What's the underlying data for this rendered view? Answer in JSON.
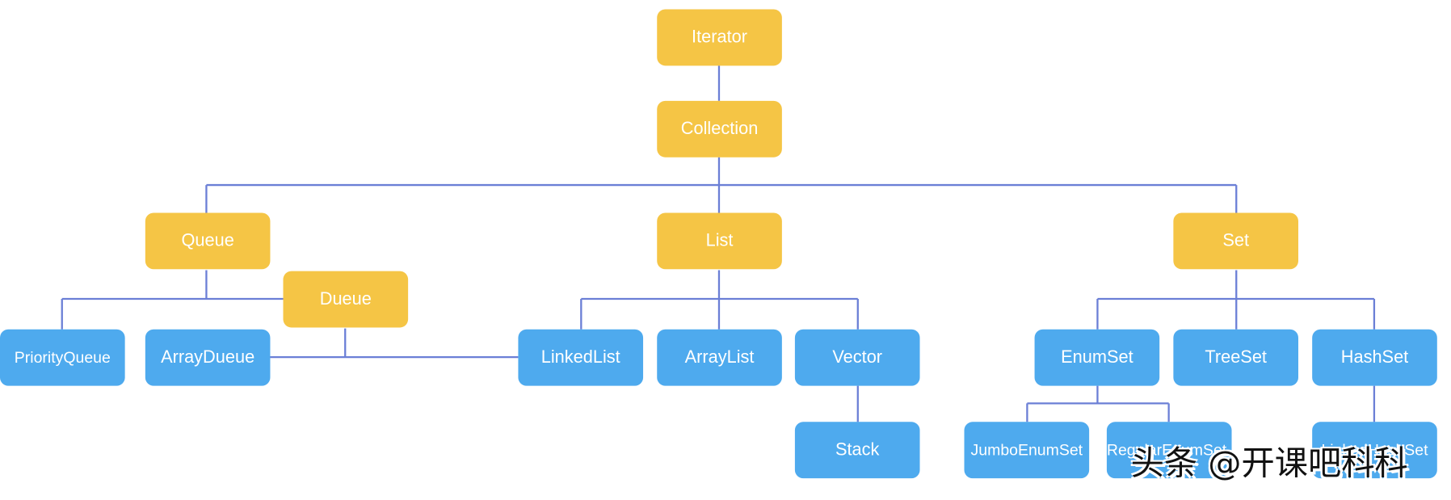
{
  "colors": {
    "interface": "#f5c545",
    "class": "#4eaaee",
    "connector": "#6b7fd6"
  },
  "nodes": {
    "iterator": "Iterator",
    "collection": "Collection",
    "queue": "Queue",
    "list": "List",
    "set": "Set",
    "dueue": "Dueue",
    "priorityqueue": "PriorityQueue",
    "arraydueue": "ArrayDueue",
    "linkedlist": "LinkedList",
    "arraylist": "ArrayList",
    "vector": "Vector",
    "enumset": "EnumSet",
    "treeset": "TreeSet",
    "hashset": "HashSet",
    "stack": "Stack",
    "jumboenumset": "JumboEnumSet",
    "regularenumset": "RegularEnumSet",
    "linkedhashset": "LinkedHashSet"
  },
  "watermark": "头条 @开课吧科科"
}
